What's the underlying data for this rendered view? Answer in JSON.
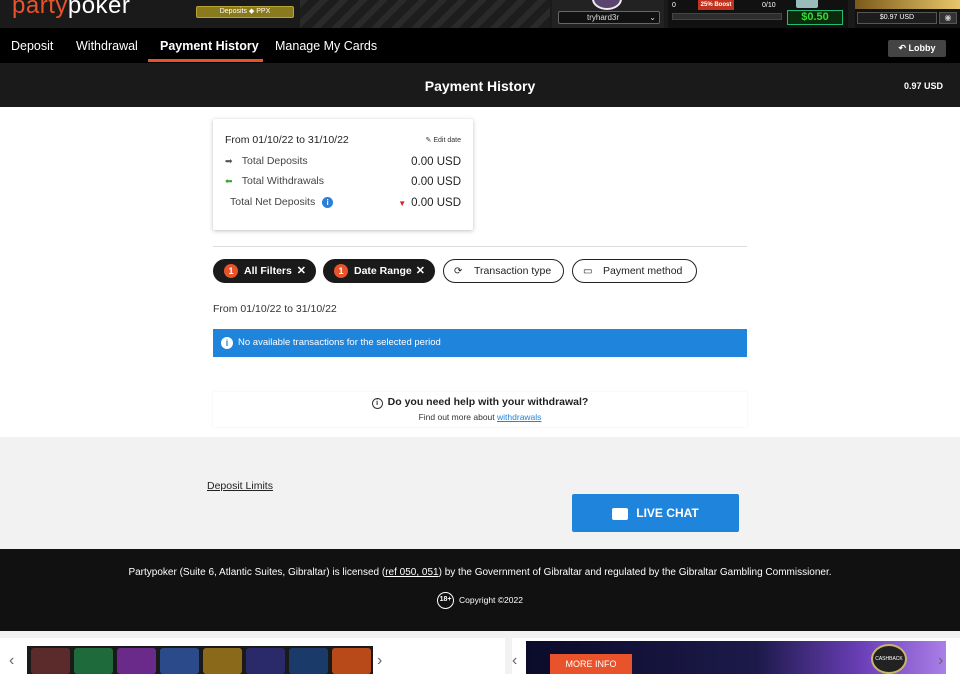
{
  "topbar": {
    "logo_party": "party",
    "logo_poker": "poker",
    "deposits_badge": "Deposits ◆ PPX",
    "username": "tryhard3r",
    "boost_count": "0",
    "boost_label": "25% Boost",
    "boost_progress": "0/10",
    "bonus_amount": "$0.50",
    "balance": "$0.97 USD"
  },
  "nav": {
    "tabs": [
      {
        "label": "Deposit"
      },
      {
        "label": "Withdrawal"
      },
      {
        "label": "Payment History"
      },
      {
        "label": "Manage My Cards"
      }
    ],
    "lobby_label": "Lobby"
  },
  "header": {
    "title": "Payment History",
    "balance": "0.97 USD"
  },
  "summary": {
    "range": "From 01/10/22 to 31/10/22",
    "edit_label": "Edit date",
    "rows": [
      {
        "label": "Total Deposits",
        "amount": "0.00 USD"
      },
      {
        "label": "Total Withdrawals",
        "amount": "0.00 USD"
      },
      {
        "label": "Total Net Deposits",
        "amount": "0.00 USD"
      }
    ]
  },
  "filters": {
    "chips": [
      {
        "label": "All Filters",
        "count": "1"
      },
      {
        "label": "Date Range",
        "count": "1"
      },
      {
        "label": "Transaction type"
      },
      {
        "label": "Payment method"
      }
    ]
  },
  "results": {
    "range_text": "From 01/10/22 to 31/10/22",
    "banner": "No available transactions for the selected period"
  },
  "help": {
    "question": "Do you need help with your withdrawal?",
    "more_prefix": "Find out more about ",
    "more_link": "withdrawals"
  },
  "band": {
    "deposit_limits": "Deposit Limits",
    "live_chat": "LIVE CHAT"
  },
  "footer": {
    "license_pre": "Partypoker (Suite 6, Atlantic Suites, Gibraltar) is licensed (",
    "license_ref": "ref 050, 051",
    "license_post": ") by the Government of Gibraltar and regulated by the Gibraltar Gambling Commissioner.",
    "age": "18+",
    "copyright": "Copyright  ©2022"
  },
  "promo": {
    "more_info": "MORE INFO",
    "cashback": "CASHBACK"
  }
}
